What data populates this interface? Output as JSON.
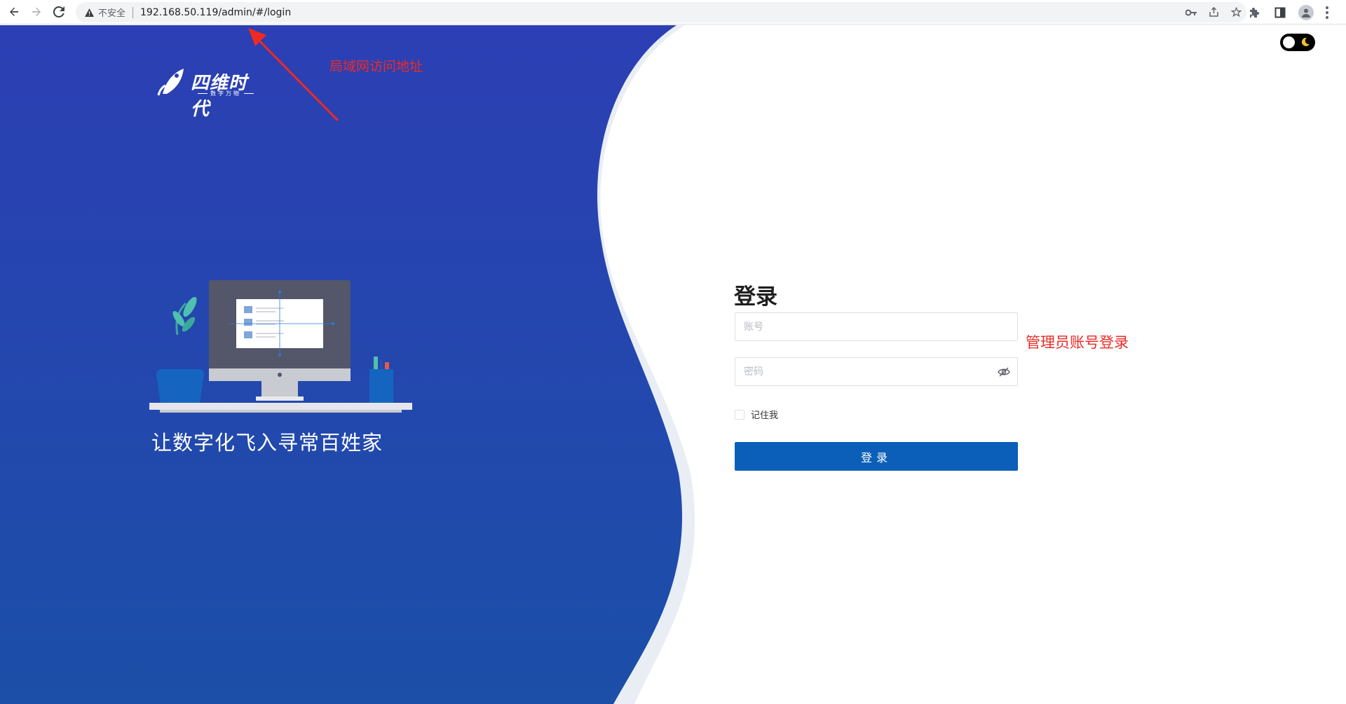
{
  "browser": {
    "security_label": "不安全",
    "url": "192.168.50.119/admin/#/login"
  },
  "brand": {
    "logo_text": "四维时代",
    "logo_subtext": "数字万物",
    "slogan": "让数字化飞入寻常百姓家"
  },
  "annotations": {
    "url_note": "局域网访问地址",
    "admin_note": "管理员账号登录"
  },
  "login": {
    "title": "登录",
    "account_placeholder": "账号",
    "password_placeholder": "密码",
    "remember_label": "记住我",
    "remember_checked": false,
    "submit_label": "登录"
  },
  "theme": {
    "mode": "light"
  },
  "colors": {
    "panel_blue_top": "#2c3fb4",
    "panel_blue_bottom": "#1b4fa8",
    "primary_button": "#0c5fb8",
    "annotation_red": "#ee2a24"
  },
  "icons": {
    "back": "arrow-left-icon",
    "forward": "arrow-right-icon",
    "reload": "reload-icon",
    "warning": "warning-triangle-icon",
    "key": "key-icon",
    "share": "share-icon",
    "bookmark": "star-icon",
    "extensions": "puzzle-icon",
    "sidepanel": "side-panel-icon",
    "profile": "avatar-icon",
    "menu": "kebab-menu-icon",
    "password_visibility": "eye-off-icon",
    "theme": "moon-icon"
  }
}
